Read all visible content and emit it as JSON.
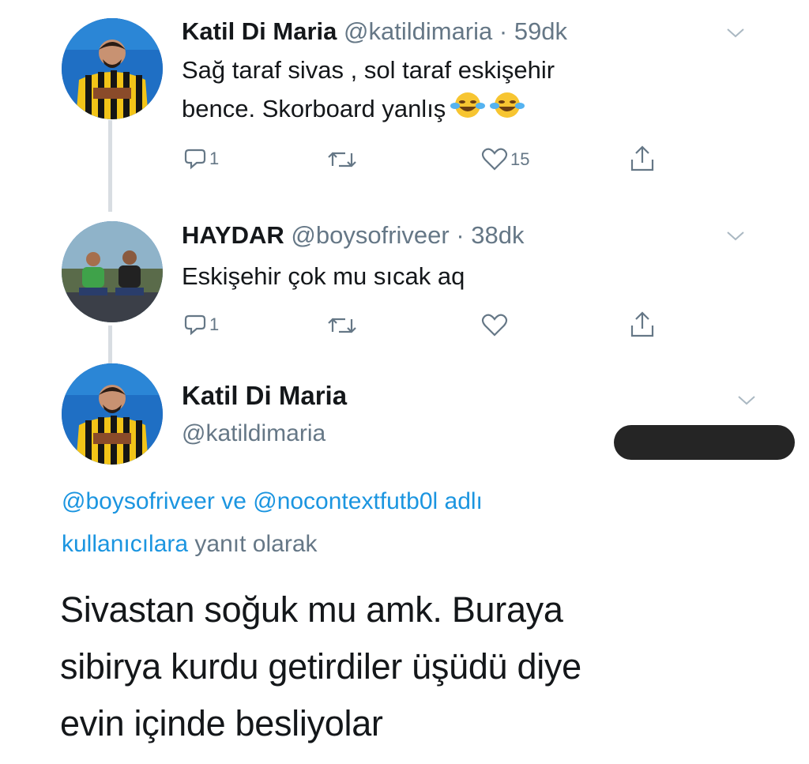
{
  "tweets": [
    {
      "name": "Katil Di Maria",
      "handle": "@katildimaria",
      "time": "· 59dk",
      "text_lines": [
        "Sağ taraf sivas , sol taraf eskişehir",
        "bence. Skorboard yanlış"
      ],
      "emojis": [
        "face-with-tears-of-joy",
        "face-with-tears-of-joy"
      ],
      "replies": "1",
      "retweets": "",
      "likes": "15"
    },
    {
      "name": "HAYDAR",
      "handle": "@boysofriveer",
      "time": "· 38dk",
      "text_lines": [
        "Eskişehir çok mu sıcak aq"
      ],
      "replies": "1",
      "retweets": "",
      "likes": ""
    }
  ],
  "main_tweet": {
    "name": "Katil Di Maria",
    "handle": "@katildimaria",
    "reply_mention_1": "@boysofriveer",
    "reply_conj": "ve",
    "reply_mention_2": "@nocontextfutb0l",
    "reply_suffix_1": "adlı",
    "reply_mention_suffix": "kullanıcılara",
    "reply_suffix_2": "yanıt olarak",
    "text_lines": [
      "Sivastan soğuk mu amk. Buraya",
      "sibirya kurdu getirdiler üşüdü diye",
      "evin içinde besliyolar"
    ]
  },
  "icons": [
    "reply-icon",
    "retweet-icon",
    "like-icon",
    "share-icon",
    "chevron-down-icon"
  ],
  "colors": {
    "link": "#1b95e0",
    "meta": "#657786",
    "text": "#14171a",
    "thread_line": "#d8dde2",
    "redaction": "#252525"
  }
}
